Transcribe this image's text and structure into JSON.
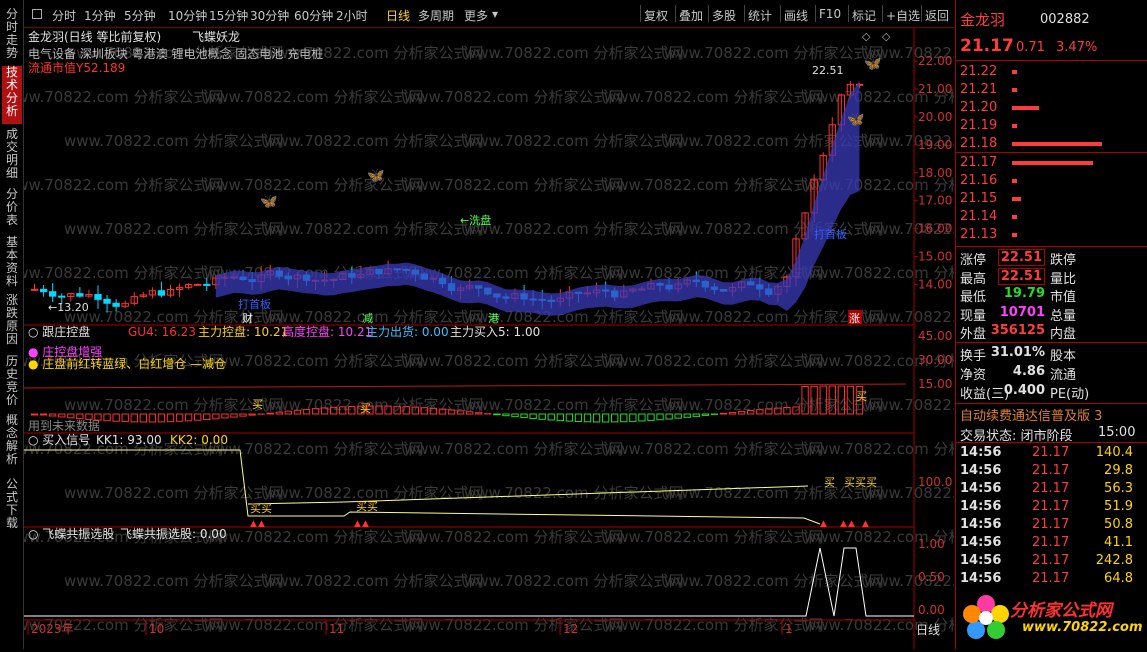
{
  "left_tabs": [
    "分时走势",
    "技术分析",
    "成交明细",
    "分价表",
    "基本资料",
    "涨跌原因",
    "历史竞价",
    "概念解析",
    "公式下载"
  ],
  "toolbar": {
    "periods": [
      "分时",
      "1分钟",
      "5分钟",
      "10分钟",
      "15分钟",
      "30分钟",
      "60分钟",
      "2小时",
      "日线",
      "多周期",
      "更多"
    ],
    "active": "日线",
    "right": [
      "复权",
      "叠加",
      "多股",
      "统计",
      "画线",
      "F10",
      "标记",
      "+自选",
      "返回"
    ]
  },
  "chart_header": {
    "title": "金龙羽(日线 等比前复权)",
    "indicator": "飞蝶妖龙",
    "concepts": "电气设备 深圳板块 粤港澳 锂电池概念 固态电池 充电桩",
    "float_cap": "流通市值Y52.189",
    "high_label": "22.51",
    "low_label": "13.20",
    "tags": [
      "打首板",
      "财",
      "减",
      "港",
      "涨",
      "打首板",
      "洗盘"
    ]
  },
  "price_axis": [
    "22.00",
    "21.00",
    "20.00",
    "19.00",
    "18.00",
    "17.00",
    "16.00",
    "15.00",
    "14.00"
  ],
  "panel2": {
    "name": "跟庄控盘",
    "items": [
      {
        "label": "GU4: 16.23",
        "color": "#ff3030"
      },
      {
        "label": "主力控盘: 10.21",
        "color": "#ffd400"
      },
      {
        "label": "高度控盘: 10.21",
        "color": "#ff40ff"
      },
      {
        "label": "主力出货: 0.00",
        "color": "#40c0ff"
      },
      {
        "label": "主力买入5: 1.00",
        "color": "#e0e0e0"
      }
    ],
    "legend1": "庄控盘增强",
    "legend2": "庄盘前红转蓝绿、白红增仓 —减仓",
    "axis": [
      "45.00",
      "30.00",
      "15.00"
    ],
    "note": "用到未来数据",
    "buy_label": "买"
  },
  "panel3": {
    "name": "买入信号",
    "kk1": "KK1: 93.00",
    "kk2": "KK2: 0.00",
    "axis": [
      "100.0"
    ],
    "buy_label": "买"
  },
  "panel4": {
    "name": "飞蝶共振选股",
    "value": "飞蝶共振选股: 0.00",
    "axis": [
      "1.00",
      "0.50",
      "0.00"
    ]
  },
  "time_axis": [
    "2023年",
    "10",
    "11",
    "12",
    "1"
  ],
  "watermark": "www.70822.com 分析家公式网",
  "quote": {
    "name": "金龙羽",
    "code": "002882",
    "price": "21.17",
    "change": "0.71",
    "pct": "3.47%",
    "asks": [
      {
        "p": "21.22",
        "v": ""
      },
      {
        "p": "21.21",
        "v": ""
      },
      {
        "p": "21.20",
        "v": ""
      },
      {
        "p": "21.19",
        "v": ""
      },
      {
        "p": "21.18",
        "v": ""
      }
    ],
    "bids": [
      {
        "p": "21.17",
        "v": ""
      },
      {
        "p": "21.16",
        "v": ""
      },
      {
        "p": "21.15",
        "v": ""
      },
      {
        "p": "21.14",
        "v": ""
      },
      {
        "p": "21.13",
        "v": ""
      }
    ],
    "ask_bars": [
      0.05,
      0.05,
      0.3,
      0.05,
      1.0
    ],
    "bid_bars": [
      0.9,
      0.05,
      0.1,
      0.05,
      0.05
    ],
    "stats": [
      {
        "l1": "涨停",
        "v1": "22.51",
        "c1": "red",
        "box": true,
        "l2": "跌停",
        "v2": "",
        "c2": "grn"
      },
      {
        "l1": "最高",
        "v1": "22.51",
        "c1": "red",
        "box": true,
        "l2": "量比",
        "v2": "",
        "c2": "wht"
      },
      {
        "l1": "最低",
        "v1": "19.79",
        "c1": "grn",
        "l2": "市值",
        "v2": "",
        "c2": "wht"
      },
      {
        "l1": "现量",
        "v1": "10701",
        "c1": "mag",
        "l2": "总量",
        "v2": "",
        "c2": "wht"
      },
      {
        "l1": "外盘",
        "v1": "356125",
        "c1": "red",
        "l2": "内盘",
        "v2": "",
        "c2": "grn"
      }
    ],
    "stats2": [
      {
        "l1": "换手",
        "v1": "31.01%",
        "c1": "wht",
        "l2": "股本"
      },
      {
        "l1": "净资",
        "v1": "4.86",
        "c1": "wht",
        "l2": "流通"
      },
      {
        "l1": "收益(三)",
        "v1": "0.400",
        "c1": "wht",
        "l2": "PE(动)"
      }
    ],
    "ticker": "自动续费通达信普及版 3",
    "status": "交易状态: 闭市阶段",
    "status_time": "15:00",
    "trades": [
      {
        "t": "14:56",
        "p": "21.17",
        "v": "140.4"
      },
      {
        "t": "14:56",
        "p": "21.17",
        "v": "29.8"
      },
      {
        "t": "14:56",
        "p": "21.17",
        "v": "56.3"
      },
      {
        "t": "14:56",
        "p": "21.17",
        "v": "51.9"
      },
      {
        "t": "14:56",
        "p": "21.17",
        "v": "50.8"
      },
      {
        "t": "14:56",
        "p": "21.17",
        "v": "41.1"
      },
      {
        "t": "14:56",
        "p": "21.17",
        "v": "242.8"
      },
      {
        "t": "14:56",
        "p": "21.17",
        "v": "64.8"
      }
    ],
    "logo_text": "分析家公式网",
    "logo_url": "www.70822.com"
  }
}
